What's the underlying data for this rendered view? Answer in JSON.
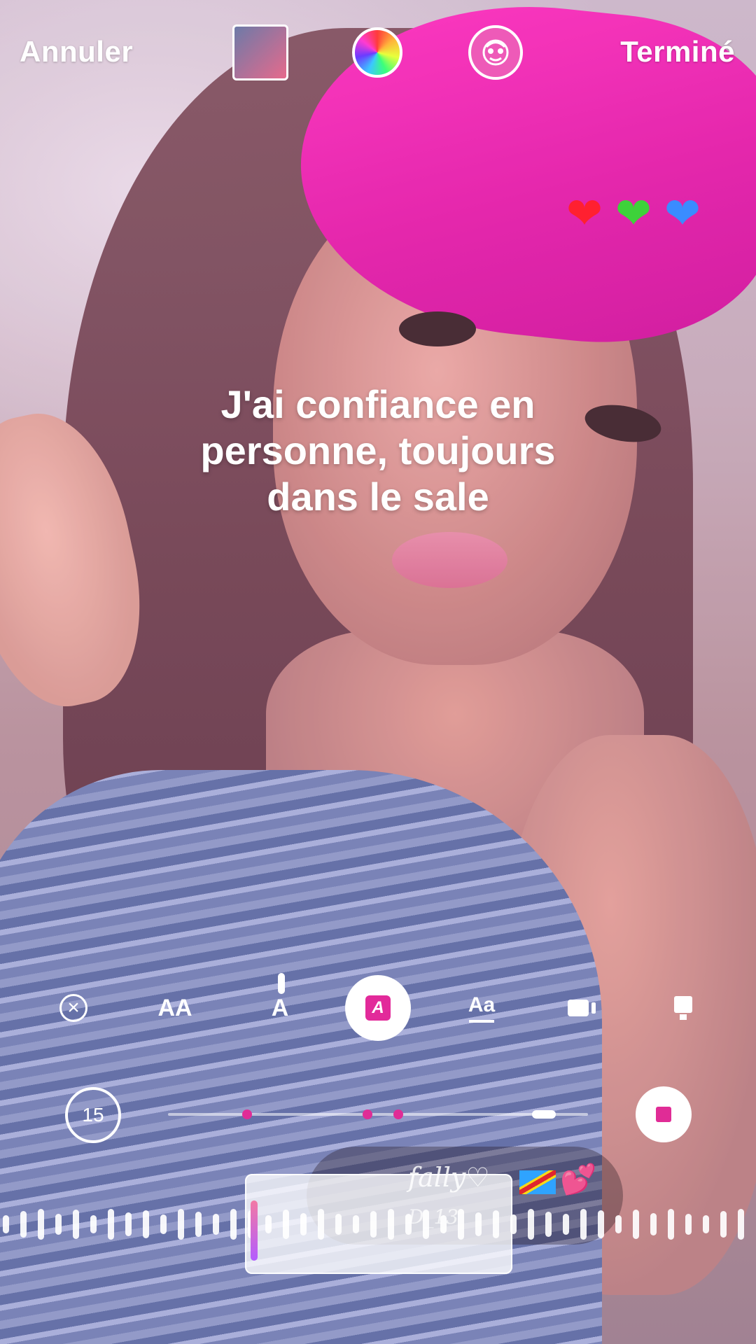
{
  "topbar": {
    "cancel_label": "Annuler",
    "done_label": "Terminé",
    "thumbnail_icon": "photo-thumbnail",
    "color_icon": "color-wheel-icon",
    "effect_icon": "face-effect-icon"
  },
  "stickers": {
    "hearts": [
      "❤",
      "❤",
      "❤"
    ],
    "heart_colors": [
      "#ff2030",
      "#3ed23a",
      "#3a8cff"
    ]
  },
  "caption": {
    "line1": "J'ai confiance en",
    "line2": "personne, toujours",
    "line3": "dans le sale"
  },
  "tools": {
    "close_icon": "×",
    "aa_label": "AA",
    "ai_label": "A",
    "active_label": "A",
    "aa2_label": "Aa"
  },
  "timer": {
    "duration": "15"
  },
  "music": {
    "user_line1": "fally♡",
    "user_line2": "D_13",
    "pink_hearts": "💕"
  },
  "colors": {
    "accent": "#e02c96",
    "headband": "#ff2fc0"
  }
}
